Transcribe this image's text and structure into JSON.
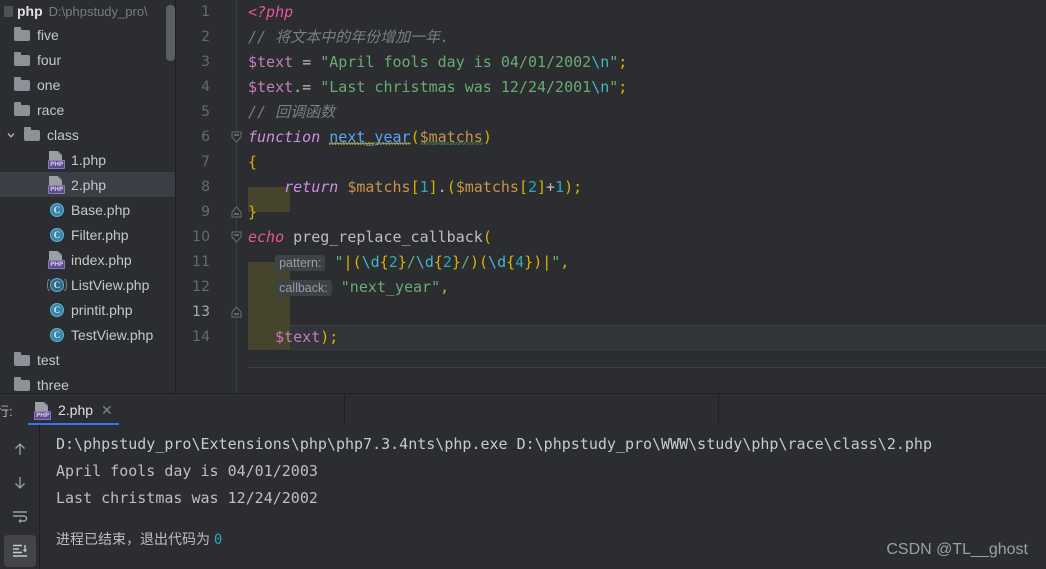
{
  "window": {
    "project_name": "php",
    "project_path": "D:\\phpstudy_pro\\"
  },
  "sidebar": {
    "items": [
      {
        "label": "five",
        "icon": "folder-icon",
        "depth": 0,
        "expandable": false,
        "selected": false
      },
      {
        "label": "four",
        "icon": "folder-icon",
        "depth": 0,
        "expandable": false,
        "selected": false
      },
      {
        "label": "one",
        "icon": "folder-icon",
        "depth": 0,
        "expandable": false,
        "selected": false
      },
      {
        "label": "race",
        "icon": "folder-icon",
        "depth": 0,
        "expandable": false,
        "selected": false
      },
      {
        "label": "class",
        "icon": "folder-icon",
        "depth": 0,
        "expandable": true,
        "selected": false
      },
      {
        "label": "1.php",
        "icon": "php-file-icon",
        "depth": 1,
        "expandable": false,
        "selected": false
      },
      {
        "label": "2.php",
        "icon": "php-file-icon",
        "depth": 1,
        "expandable": false,
        "selected": true
      },
      {
        "label": "Base.php",
        "icon": "php-class-icon",
        "depth": 1,
        "expandable": false,
        "selected": false
      },
      {
        "label": "Filter.php",
        "icon": "php-class-icon",
        "depth": 1,
        "expandable": false,
        "selected": false
      },
      {
        "label": "index.php",
        "icon": "php-file-icon",
        "depth": 1,
        "expandable": false,
        "selected": false
      },
      {
        "label": "ListView.php",
        "icon": "php-abstract-class-icon",
        "depth": 1,
        "expandable": false,
        "selected": false
      },
      {
        "label": "printit.php",
        "icon": "php-class-icon",
        "depth": 1,
        "expandable": false,
        "selected": false
      },
      {
        "label": "TestView.php",
        "icon": "php-class-icon",
        "depth": 1,
        "expandable": false,
        "selected": false
      },
      {
        "label": "test",
        "icon": "folder-icon",
        "depth": 0,
        "expandable": false,
        "selected": false
      },
      {
        "label": "three",
        "icon": "folder-icon",
        "depth": 0,
        "expandable": false,
        "selected": false
      }
    ]
  },
  "editor": {
    "current_line": 13,
    "line_numbers": [
      "1",
      "2",
      "3",
      "4",
      "5",
      "6",
      "7",
      "8",
      "9",
      "10",
      "11",
      "12",
      "13",
      "14"
    ],
    "lines": [
      {
        "n": 1,
        "text": "<?php"
      },
      {
        "n": 2,
        "text": "// 将文本中的年份增加一年."
      },
      {
        "n": 3,
        "text": "$text = \"April fools day is 04/01/2002\\n\";"
      },
      {
        "n": 4,
        "text": "$text.= \"Last christmas was 12/24/2001\\n\";"
      },
      {
        "n": 5,
        "text": "// 回调函数"
      },
      {
        "n": 6,
        "text": "function next_year($matchs)"
      },
      {
        "n": 7,
        "text": "{"
      },
      {
        "n": 8,
        "text": "    return $matchs[1].($matchs[2]+1);"
      },
      {
        "n": 9,
        "text": "}"
      },
      {
        "n": 10,
        "text": "echo preg_replace_callback("
      },
      {
        "n": 11,
        "text": "    pattern: \"|(\\d{2}/\\d{2}/)(\\d{4})|\","
      },
      {
        "n": 12,
        "text": "    callback: \"next_year\","
      },
      {
        "n": 13,
        "text": "    $text);"
      },
      {
        "n": 14,
        "text": ""
      }
    ],
    "param_hints": [
      "pattern:",
      "callback:"
    ]
  },
  "run_panel": {
    "window_label": "行:",
    "tab_label": "2.php",
    "tab_icon": "php-run-config-icon",
    "close_icon": "close-icon",
    "toolbar_buttons": [
      {
        "name": "up-arrow-icon",
        "active": false
      },
      {
        "name": "down-arrow-icon",
        "active": false
      },
      {
        "name": "soft-wrap-icon",
        "active": false
      },
      {
        "name": "scroll-to-end-icon",
        "active": true
      }
    ],
    "console_lines": [
      {
        "kind": "cmd",
        "text": "D:\\phpstudy_pro\\Extensions\\php\\php7.3.4nts\\php.exe D:\\phpstudy_pro\\WWW\\study\\php\\race\\class\\2.php"
      },
      {
        "kind": "out",
        "text": "April fools day is 04/01/2003"
      },
      {
        "kind": "out",
        "text": "Last christmas was 12/24/2002"
      },
      {
        "kind": "blank",
        "text": ""
      }
    ],
    "exit_text": "进程已结束，退出代码为",
    "exit_code": "0"
  },
  "watermark": {
    "text": "CSDN @TL__ghost"
  },
  "colors": {
    "background": "#2b2d30",
    "selection": "#3a3f46",
    "accent": "#3574f0",
    "current_line": "#323438",
    "indent_highlight": "#46442c",
    "string": "#6aab73",
    "keyword": "#cf8ee6",
    "comment": "#7a7e85",
    "number": "#2aacb8",
    "function": "#56a8f5"
  }
}
